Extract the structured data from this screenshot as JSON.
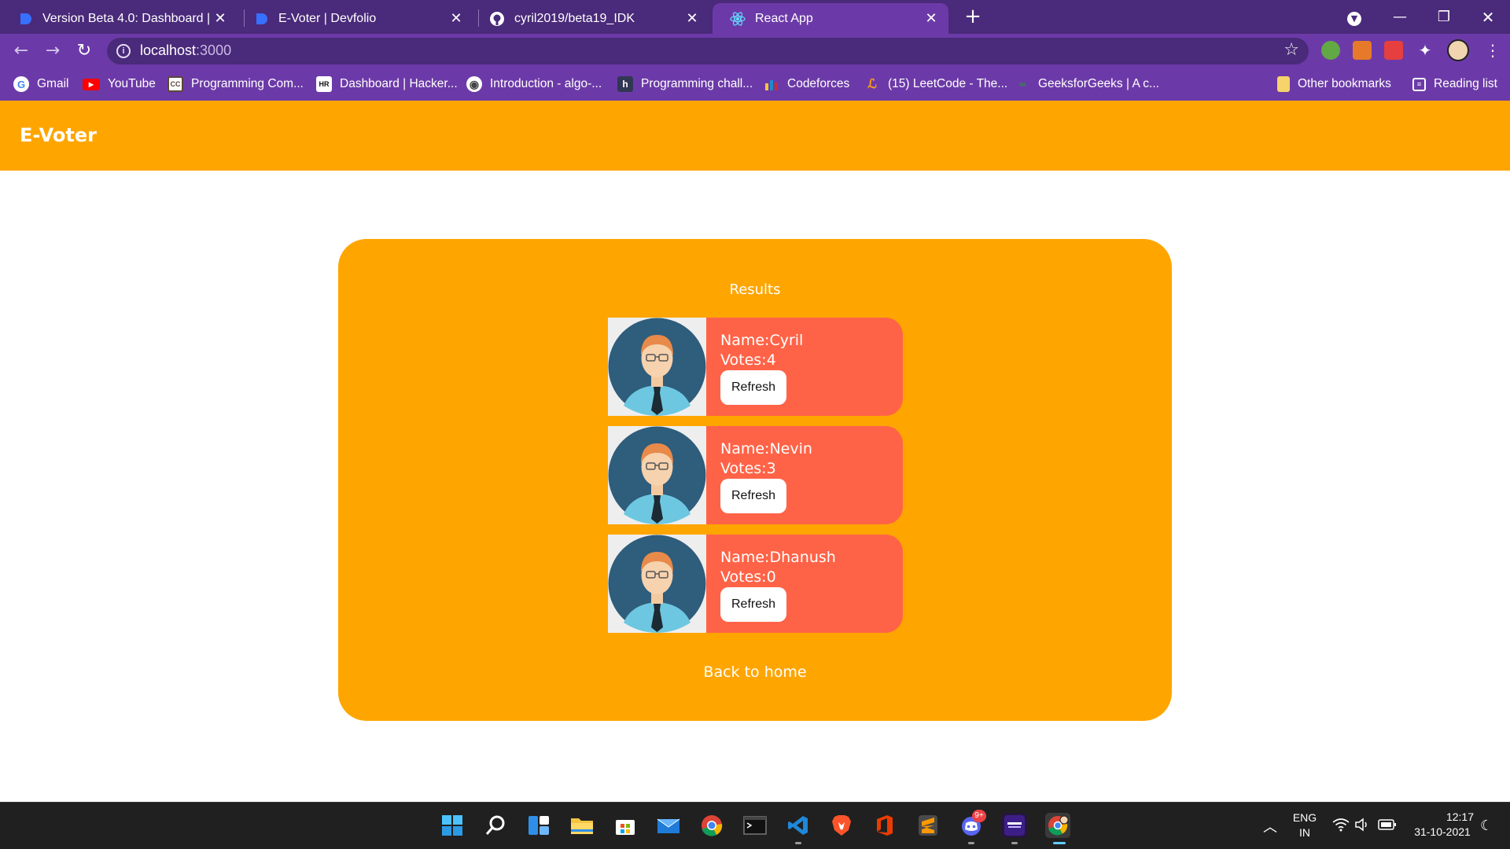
{
  "browser": {
    "tabs": [
      {
        "title": "Version Beta 4.0: Dashboard | De",
        "icon": "devfolio-icon",
        "active": false
      },
      {
        "title": "E-Voter | Devfolio",
        "icon": "devfolio-icon",
        "active": false
      },
      {
        "title": "cyril2019/beta19_IDK",
        "icon": "github-icon",
        "active": false
      },
      {
        "title": "React App",
        "icon": "react-icon",
        "active": true
      }
    ],
    "url_host": "localhost",
    "url_port": ":3000",
    "bookmarks": [
      {
        "label": "Gmail",
        "icon": "google-icon"
      },
      {
        "label": "YouTube",
        "icon": "youtube-icon"
      },
      {
        "label": "Programming Com...",
        "icon": "codechef-icon"
      },
      {
        "label": "Dashboard | Hacker...",
        "icon": "hackerrank-icon"
      },
      {
        "label": "Introduction - algo-...",
        "icon": "globe-icon"
      },
      {
        "label": "Programming chall...",
        "icon": "hackerearth-icon"
      },
      {
        "label": "Codeforces",
        "icon": "codeforces-icon"
      },
      {
        "label": "(15) LeetCode - The...",
        "icon": "leetcode-icon"
      },
      {
        "label": "GeeksforGeeks | A c...",
        "icon": "gfg-icon"
      }
    ],
    "other_bookmarks": "Other bookmarks",
    "reading_list": "Reading list"
  },
  "app": {
    "brand": "E-Voter",
    "results_title": "Results",
    "candidates": [
      {
        "name_line": "Name:Cyril",
        "votes_line": "Votes:4",
        "refresh_label": "Refresh"
      },
      {
        "name_line": "Name:Nevin",
        "votes_line": "Votes:3",
        "refresh_label": "Refresh"
      },
      {
        "name_line": "Name:Dhanush",
        "votes_line": "Votes:0",
        "refresh_label": "Refresh"
      }
    ],
    "back_label": "Back to home"
  },
  "taskbar": {
    "lang": "ENG",
    "region": "IN",
    "time": "12:17",
    "date": "31-10-2021",
    "discord_badge": "9+"
  }
}
